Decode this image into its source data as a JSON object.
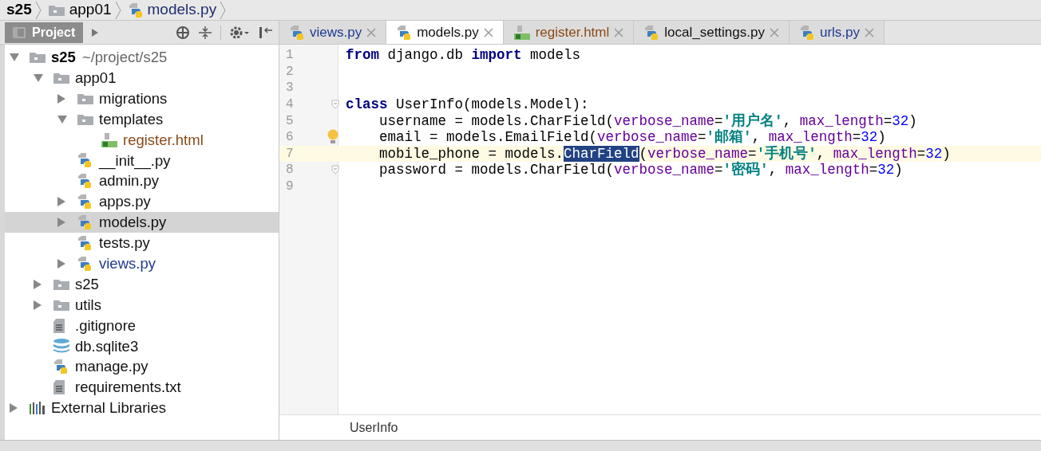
{
  "breadcrumbs": [
    {
      "label": "s25",
      "kind": "project"
    },
    {
      "label": "app01",
      "kind": "folder"
    },
    {
      "label": "models.py",
      "kind": "python"
    }
  ],
  "project_panel": {
    "title": "Project"
  },
  "tabs": [
    {
      "label": "views.py",
      "kind": "python",
      "color": "#1f3a8f",
      "selected": false
    },
    {
      "label": "models.py",
      "kind": "python",
      "selected": true
    },
    {
      "label": "register.html",
      "kind": "html",
      "color": "#8a4b1a",
      "selected": false
    },
    {
      "label": "local_settings.py",
      "kind": "python",
      "selected": false
    },
    {
      "label": "urls.py",
      "kind": "python",
      "color": "#1f3a8f",
      "selected": false
    }
  ],
  "tree": [
    {
      "label": "s25",
      "path": "~/project/s25",
      "kind": "project",
      "expanded": true,
      "selected": false,
      "children": [
        {
          "label": "app01",
          "kind": "folder",
          "expanded": true,
          "selected": false,
          "children": [
            {
              "label": "migrations",
              "kind": "folder",
              "expanded": false,
              "selected": false
            },
            {
              "label": "templates",
              "kind": "folder",
              "expanded": true,
              "selected": false,
              "children": [
                {
                  "label": "register.html",
                  "kind": "html",
                  "color": "#8a4b1a",
                  "selected": false
                }
              ]
            },
            {
              "label": "__init__.py",
              "kind": "python",
              "selected": false
            },
            {
              "label": "admin.py",
              "kind": "python",
              "selected": false
            },
            {
              "label": "apps.py",
              "kind": "python",
              "expanded": false,
              "selected": false
            },
            {
              "label": "models.py",
              "kind": "python",
              "expanded": false,
              "selected": true
            },
            {
              "label": "tests.py",
              "kind": "python",
              "selected": false
            },
            {
              "label": "views.py",
              "kind": "python",
              "color": "#1f3a8f",
              "expanded": false,
              "selected": false
            }
          ]
        },
        {
          "label": "s25",
          "kind": "folder",
          "expanded": false,
          "selected": false
        },
        {
          "label": "utils",
          "kind": "folder",
          "expanded": false,
          "selected": false
        },
        {
          "label": ".gitignore",
          "kind": "text",
          "selected": false
        },
        {
          "label": "db.sqlite3",
          "kind": "database",
          "selected": false
        },
        {
          "label": "manage.py",
          "kind": "python",
          "selected": false
        },
        {
          "label": "requirements.txt",
          "kind": "text",
          "selected": false
        }
      ]
    },
    {
      "label": "External Libraries",
      "kind": "library",
      "expanded": false,
      "selected": false
    }
  ],
  "editor": {
    "lines": [
      {
        "number": "1",
        "current": false,
        "segments": [
          {
            "kind": "keyword",
            "text": "from"
          },
          {
            "kind": "plain",
            "text": " django.db "
          },
          {
            "kind": "keyword",
            "text": "import"
          },
          {
            "kind": "plain",
            "text": " models"
          }
        ]
      },
      {
        "number": "2",
        "current": false
      },
      {
        "number": "3",
        "current": false
      },
      {
        "number": "4",
        "current": false,
        "fold": true,
        "segments": [
          {
            "kind": "keyword",
            "text": "class"
          },
          {
            "kind": "plain",
            "text": " UserInfo(models.Model):"
          }
        ]
      },
      {
        "number": "5",
        "current": false,
        "segments": [
          {
            "kind": "plain",
            "text": "    username = models.CharField("
          },
          {
            "kind": "param",
            "text": "verbose_name"
          },
          {
            "kind": "plain",
            "text": "="
          },
          {
            "kind": "string",
            "text": "'用户名'"
          },
          {
            "kind": "plain",
            "text": ", "
          },
          {
            "kind": "param",
            "text": "max_length"
          },
          {
            "kind": "plain",
            "text": "="
          },
          {
            "kind": "number",
            "text": "32"
          },
          {
            "kind": "plain",
            "text": ")"
          }
        ]
      },
      {
        "number": "6",
        "current": false,
        "bulb": true,
        "segments": [
          {
            "kind": "plain",
            "text": "    email = models.EmailField("
          },
          {
            "kind": "param",
            "text": "verbose_name"
          },
          {
            "kind": "plain",
            "text": "="
          },
          {
            "kind": "string",
            "text": "'邮箱'"
          },
          {
            "kind": "plain",
            "text": ", "
          },
          {
            "kind": "param",
            "text": "max_length"
          },
          {
            "kind": "plain",
            "text": "="
          },
          {
            "kind": "number",
            "text": "32"
          },
          {
            "kind": "plain",
            "text": ")"
          }
        ]
      },
      {
        "number": "7",
        "current": true,
        "segments": [
          {
            "kind": "plain",
            "text": "    mobile_phone = models."
          },
          {
            "kind": "selection",
            "text": "CharField"
          },
          {
            "kind": "plain",
            "text": "("
          },
          {
            "kind": "param",
            "text": "verbose_name"
          },
          {
            "kind": "plain",
            "text": "="
          },
          {
            "kind": "string",
            "text": "'手机号'"
          },
          {
            "kind": "plain",
            "text": ", "
          },
          {
            "kind": "param",
            "text": "max_length"
          },
          {
            "kind": "plain",
            "text": "="
          },
          {
            "kind": "number",
            "text": "32"
          },
          {
            "kind": "plain",
            "text": ")"
          }
        ]
      },
      {
        "number": "8",
        "current": false,
        "fold": true,
        "segments": [
          {
            "kind": "plain",
            "text": "    password = models.CharField("
          },
          {
            "kind": "param",
            "text": "verbose_name"
          },
          {
            "kind": "plain",
            "text": "="
          },
          {
            "kind": "string",
            "text": "'密码'"
          },
          {
            "kind": "plain",
            "text": ", "
          },
          {
            "kind": "param",
            "text": "max_length"
          },
          {
            "kind": "plain",
            "text": "="
          },
          {
            "kind": "number",
            "text": "32"
          },
          {
            "kind": "plain",
            "text": ")"
          }
        ]
      },
      {
        "number": "9",
        "current": false
      }
    ],
    "breadcrumb": "UserInfo"
  }
}
